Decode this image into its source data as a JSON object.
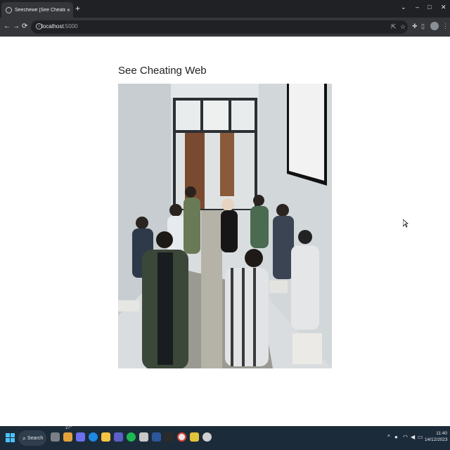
{
  "browser": {
    "tab_title": "Seechewe [See Cheating Web]",
    "tab_close": "×",
    "new_tab": "+",
    "window_controls": [
      "⌄",
      "–",
      "□",
      "✕"
    ],
    "url_host": "localhost",
    "url_port": ":5000",
    "nav": {
      "back": "←",
      "forward": "→",
      "reload": "⟳"
    },
    "toolbar_icons": [
      "share-icon",
      "star-icon",
      "extensions-icon",
      "sidebar-icon",
      "profile-avatar",
      "menu-icon"
    ]
  },
  "page": {
    "heading": "See Cheating Web",
    "image_description_role": "classroom-camera-feed"
  },
  "taskbar": {
    "search_label": "Search",
    "weather": "27°",
    "time": "11:40",
    "date": "14/12/2023",
    "tray_chevron": "^"
  },
  "colors": {
    "tabbar_bg": "#202124",
    "toolbar_bg": "#35363a",
    "taskbar_bg": "#1c2b3a",
    "page_bg": "#ffffff"
  }
}
